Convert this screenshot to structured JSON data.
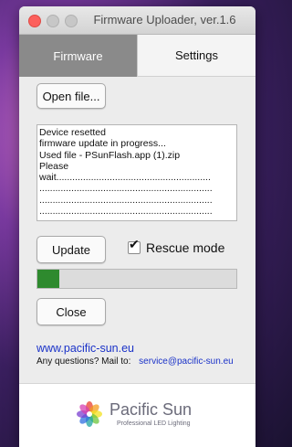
{
  "window": {
    "title": "Firmware Uploader, ver.1.6"
  },
  "tabs": [
    {
      "label": "Firmware",
      "active": true
    },
    {
      "label": "Settings",
      "active": false
    }
  ],
  "buttons": {
    "open_file": "Open file...",
    "update": "Update",
    "close": "Close"
  },
  "log": {
    "lines": [
      "Device resetted",
      "firmware update in progress...",
      "Used file - PSunFlash.app (1).zip",
      "Please",
      "wait..........................................................",
      ".................................................................",
      ".................................................................",
      ".................................................................",
      "................................................................."
    ]
  },
  "rescue_mode": {
    "label": "Rescue mode",
    "checked": true
  },
  "progress": {
    "fraction": 0.11,
    "color": "#2e8a2e"
  },
  "links": {
    "website": "www.pacific-sun.eu",
    "contact_prefix": "Any questions? Mail to:",
    "email": "service@pacific-sun.eu"
  },
  "footer": {
    "brand": "Pacific Sun",
    "tagline": "Professional LED Lighting",
    "logo_icon": "color-wheel-logo"
  },
  "colors": {
    "accent_link": "#1a32c8",
    "active_tab": "#8a8a8a"
  }
}
